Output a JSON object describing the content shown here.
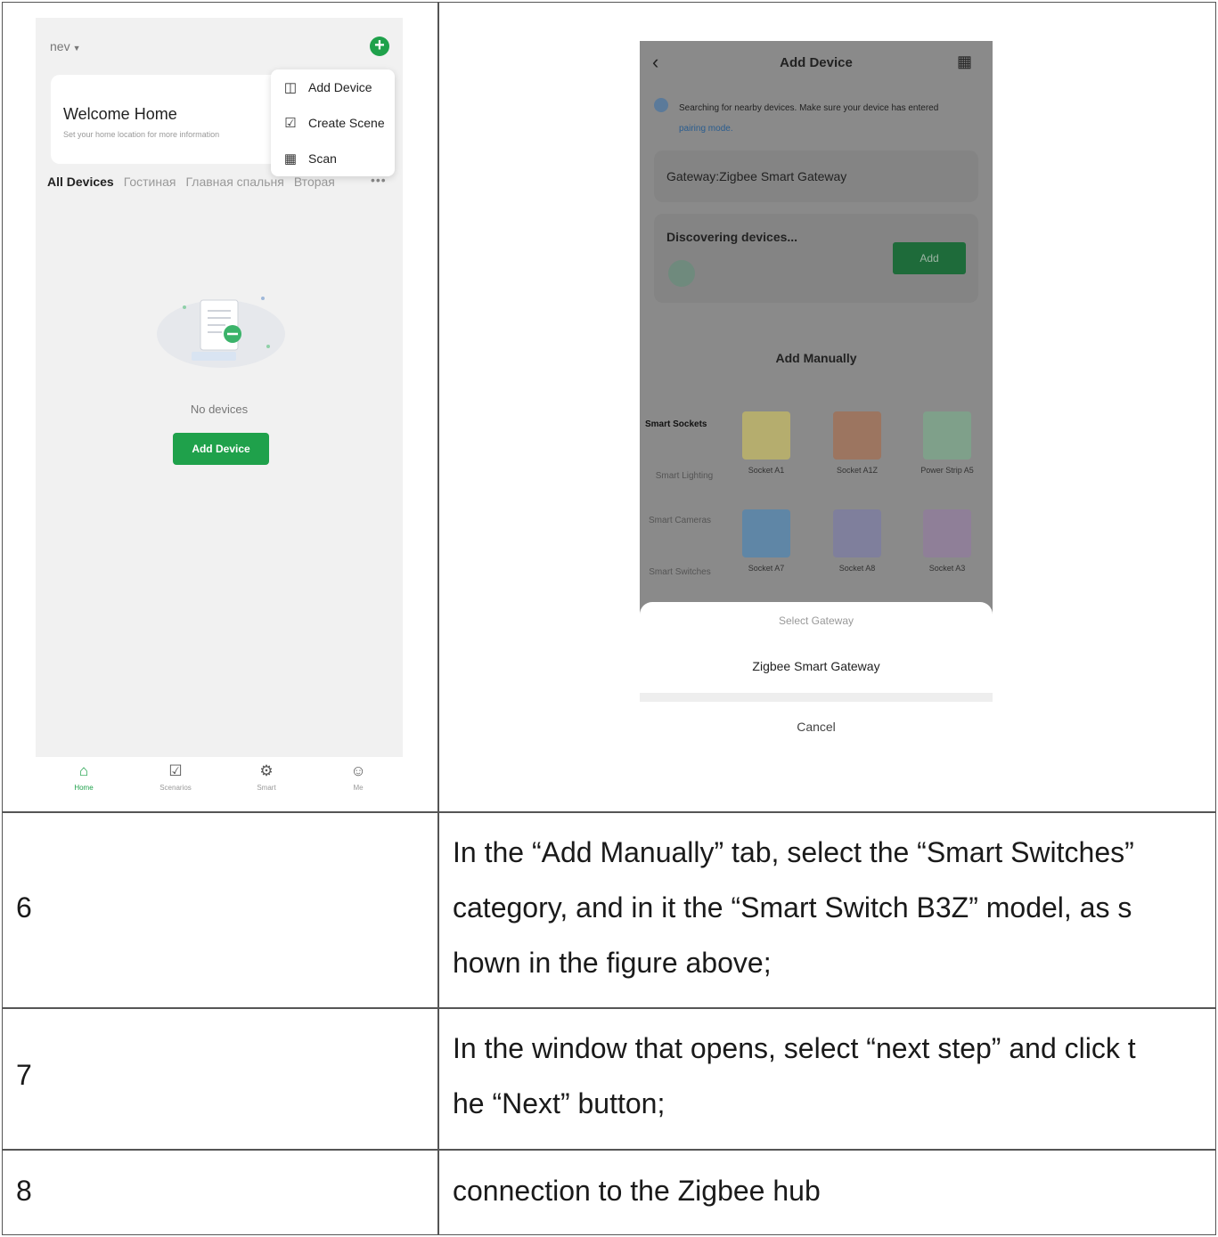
{
  "screen_left": {
    "home_name": "nev",
    "welcome_title": "Welcome Home",
    "welcome_subtitle": "Set your home location for more information",
    "room_tabs": [
      "All Devices",
      "Гостиная",
      "Главная спальня",
      "Вторая"
    ],
    "more_label": "•••",
    "menu": [
      {
        "icon": "add-device-icon",
        "label": "Add Device"
      },
      {
        "icon": "create-scene-icon",
        "label": "Create Scene"
      },
      {
        "icon": "scan-icon",
        "label": "Scan"
      }
    ],
    "empty_text": "No devices",
    "add_device_button": "Add Device",
    "tabbar": [
      {
        "icon": "home-icon",
        "label": "Home"
      },
      {
        "icon": "scenarios-icon",
        "label": "Scenarios"
      },
      {
        "icon": "smart-icon",
        "label": "Smart"
      },
      {
        "icon": "me-icon",
        "label": "Me"
      }
    ],
    "accent_color": "#1fa14b"
  },
  "screen_right": {
    "title": "Add Device",
    "info_text": "Searching for nearby devices. Make sure your device has entered",
    "info_link": "pairing mode.",
    "gateway_label": "Gateway:Zigbee Smart Gateway",
    "discovering_label": "Discovering devices...",
    "add_button": "Add",
    "add_manually": "Add Manually",
    "categories": [
      "Smart Sockets",
      "Smart Lighting",
      "Smart Cameras",
      "Smart Switches"
    ],
    "products": [
      {
        "label": "Socket A1",
        "color": "#b5ad6e"
      },
      {
        "label": "Socket A1Z",
        "color": "#9c7560"
      },
      {
        "label": "Power Strip A5",
        "color": "#7fa08a"
      },
      {
        "label": "Socket A7",
        "color": "#5f86a6"
      },
      {
        "label": "Socket A8",
        "color": "#7f7f9c"
      },
      {
        "label": "Socket A3",
        "color": "#8f7f98"
      }
    ],
    "sheet_title": "Select Gateway",
    "sheet_option": "Zigbee Smart Gateway",
    "sheet_cancel": "Cancel"
  },
  "rows": [
    {
      "step": "6",
      "lines": [
        "In the “Add Manually” tab, select the “Smart Switches”",
        "category, and in it the “Smart Switch B3Z” model, as s",
        "hown in the figure above;"
      ]
    },
    {
      "step": "7",
      "lines": [
        "In the window that opens, select “next step” and click t",
        "he “Next” button;"
      ]
    },
    {
      "step": "8",
      "lines": [
        "connection to the Zigbee hub"
      ]
    }
  ]
}
